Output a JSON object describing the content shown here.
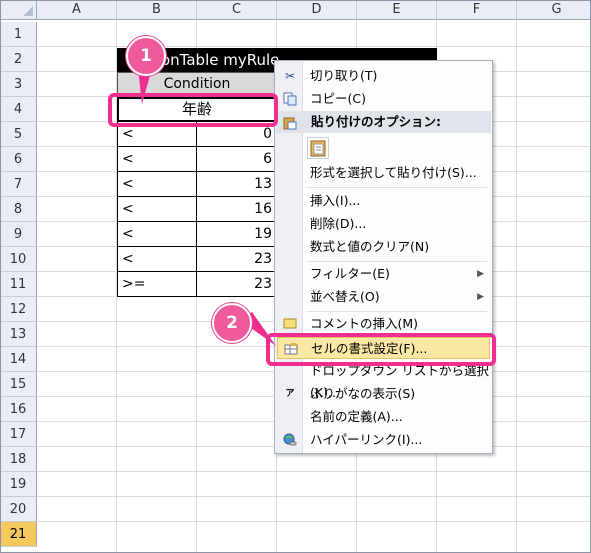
{
  "sheet": {
    "columns": [
      "A",
      "B",
      "C",
      "D",
      "E",
      "F",
      "G"
    ],
    "rows": [
      "1",
      "2",
      "3",
      "4",
      "5",
      "6",
      "7",
      "8",
      "9",
      "10",
      "11",
      "12",
      "13",
      "14",
      "15",
      "16",
      "17",
      "18",
      "19",
      "20",
      "21"
    ],
    "selected_row": "21"
  },
  "table": {
    "title": "onTable myRule",
    "header": "Condition",
    "selected_cell": "年齢",
    "rows": [
      {
        "op": "<",
        "val": "0"
      },
      {
        "op": "<",
        "val": "6"
      },
      {
        "op": "<",
        "val": "13"
      },
      {
        "op": "<",
        "val": "16"
      },
      {
        "op": "<",
        "val": "19"
      },
      {
        "op": "<",
        "val": "23"
      },
      {
        "op": ">=",
        "val": "23"
      }
    ]
  },
  "context_menu": {
    "cut": "切り取り(T)",
    "copy": "コピー(C)",
    "paste_options": "貼り付けのオプション:",
    "paste_special": "形式を選択して貼り付け(S)...",
    "insert": "挿入(I)...",
    "delete": "削除(D)...",
    "clear": "数式と値のクリア(N)",
    "filter": "フィルター(E)",
    "sort": "並べ替え(O)",
    "insert_comment": "コメントの挿入(M)",
    "format_cells": "セルの書式設定(F)...",
    "dropdown_list": "ドロップダウン リストから選択(K)...",
    "phonetic": "ふりがなの表示(S)",
    "define_name": "名前の定義(A)...",
    "hyperlink": "ハイパーリンク(I)..."
  },
  "callouts": {
    "one": "1",
    "two": "2"
  },
  "colors": {
    "accent_pink": "#ee2f8f",
    "highlight": "#fbe8a5",
    "selected_row_header": "#f5c85d"
  }
}
